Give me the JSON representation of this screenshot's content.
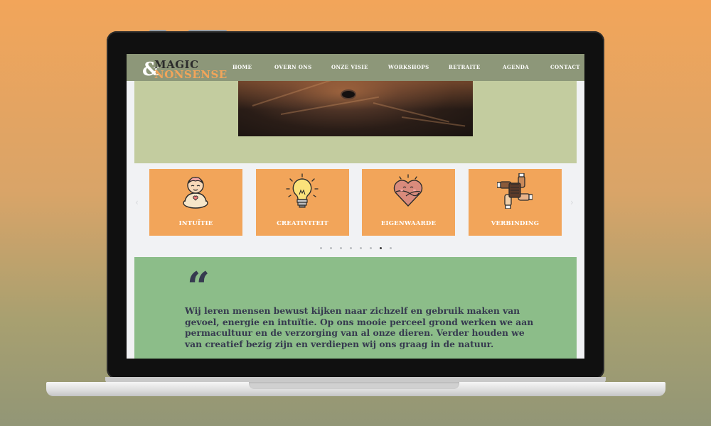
{
  "colors": {
    "background_top": "#f2a55a",
    "background_bottom": "#929676",
    "navbar": "#8d9779",
    "hero_band": "#c3cc9f",
    "card": "#f2a55a",
    "quote_band": "#8cbd89",
    "text_dark": "#363a4f"
  },
  "logo": {
    "ampersand": "&",
    "line1": "MAGIC",
    "line2": "NONSENSE"
  },
  "nav": {
    "items": [
      "HOME",
      "OVERN ONS",
      "ONZE VISIE",
      "WORKSHOPS",
      "RETRAITE",
      "AGENDA",
      "CONTACT"
    ]
  },
  "hero": {
    "image_icon": "horse-photo"
  },
  "cards": [
    {
      "label": "INTUÏTIE",
      "icon": "meditating-person-icon"
    },
    {
      "label": "CREATIVITEIT",
      "icon": "lightbulb-icon"
    },
    {
      "label": "EIGENWAARDE",
      "icon": "self-hug-heart-icon"
    },
    {
      "label": "VERBINDING",
      "icon": "joined-hands-icon"
    }
  ],
  "carousel": {
    "prev_icon": "chevron-left-icon",
    "next_icon": "chevron-right-icon",
    "dot_count": 8,
    "active_dot": 6
  },
  "quote": {
    "mark": "“",
    "text": "Wij leren mensen bewust kijken naar zichzelf en gebruik maken van gevoel, energie en intuïtie. Op ons mooie perceel grond werken we aan permacultuur en de verzorging van al onze dieren. Verder houden we van creatief bezig zijn en verdiepen wij ons graag in de natuur."
  }
}
